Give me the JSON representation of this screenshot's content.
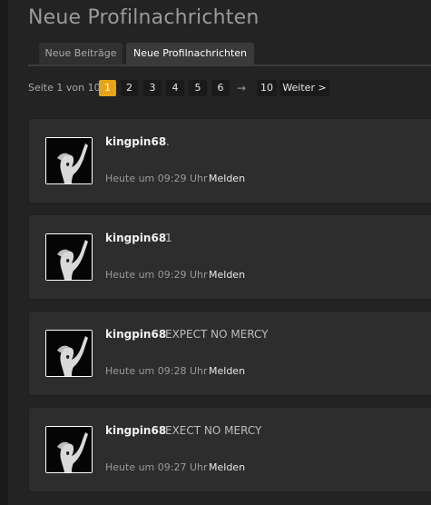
{
  "page": {
    "title": "Neue Profilnachrichten"
  },
  "tabs": [
    {
      "label": "Neue Beiträge",
      "active": false
    },
    {
      "label": "Neue Profilnachrichten",
      "active": true
    }
  ],
  "pagination": {
    "label": "Seite 1 von 10",
    "pages": [
      "1",
      "2",
      "3",
      "4",
      "5",
      "6"
    ],
    "current": "1",
    "arrow": "→",
    "last": "10",
    "next_label": "Weiter >"
  },
  "messages": [
    {
      "user": "kingpin68",
      "text": ".",
      "time": "Heute um 09:29 Uhr",
      "report_label": "Melden"
    },
    {
      "user": "kingpin68",
      "text": "1",
      "time": "Heute um 09:29 Uhr",
      "report_label": "Melden"
    },
    {
      "user": "kingpin68",
      "text": "EXPECT NO MERCY",
      "time": "Heute um 09:28 Uhr",
      "report_label": "Melden"
    },
    {
      "user": "kingpin68",
      "text": "EXECT NO MERCY",
      "time": "Heute um 09:27 Uhr",
      "report_label": "Melden"
    }
  ],
  "colors": {
    "background": "#232323",
    "panel": "#2d2d2d",
    "current_page": "#e8a418"
  }
}
